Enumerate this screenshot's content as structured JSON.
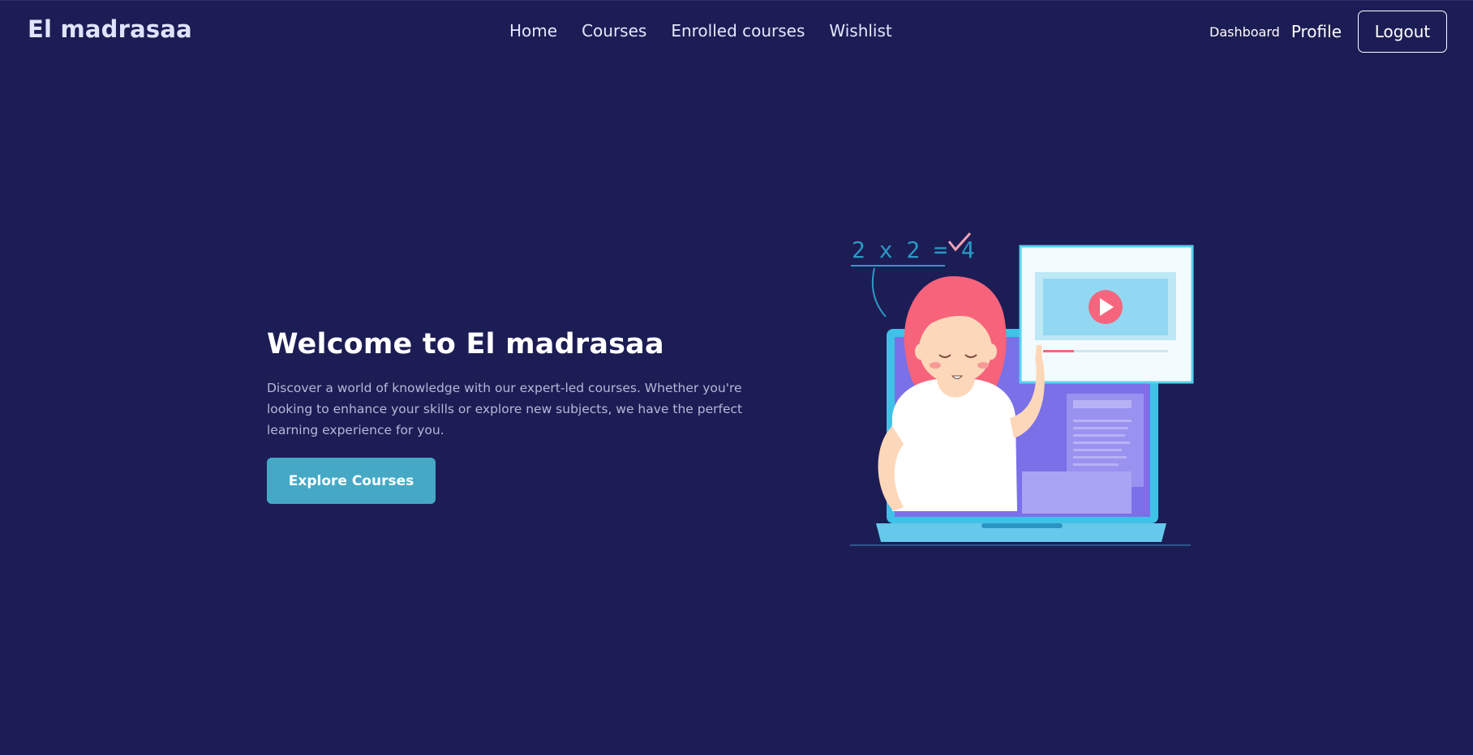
{
  "nav": {
    "brand": "El madrasaa",
    "links": [
      "Home",
      "Courses",
      "Enrolled courses",
      "Wishlist"
    ],
    "dashboard": "Dashboard",
    "profile": "Profile",
    "logout": "Logout"
  },
  "hero": {
    "title": "Welcome to El madrasaa",
    "description": "Discover a world of knowledge with our expert-led courses. Whether you're looking to enhance your skills or explore new subjects, we have the perfect learning experience for you.",
    "cta": "Explore Courses",
    "equation": "2 x 2 = 4"
  },
  "colors": {
    "background": "#1d1d55",
    "accent": "#45a9c6",
    "text": "#ffffff"
  }
}
